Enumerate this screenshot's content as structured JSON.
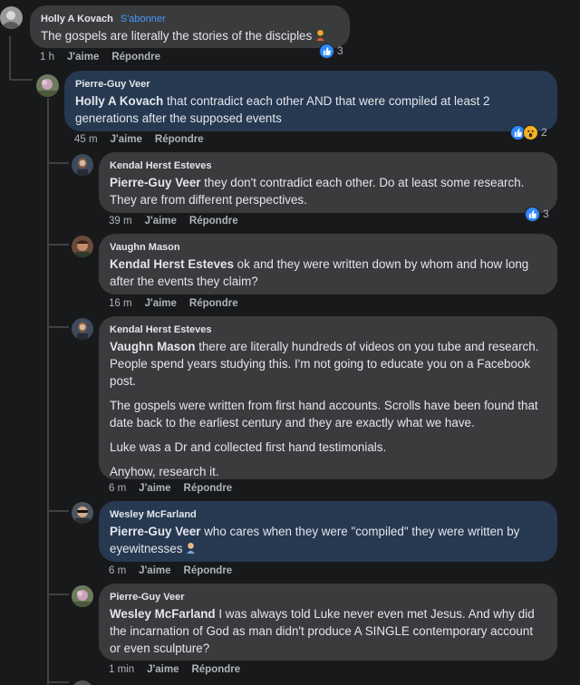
{
  "labels": {
    "like": "J'aime",
    "reply": "Répondre",
    "follow": "S'abonner"
  },
  "comments": [
    {
      "author": "Holly A Kovach",
      "mention": "",
      "text": "The gospels are literally the stories of the disciples",
      "time": "1 h",
      "reactions": "3"
    },
    {
      "author": "Pierre-Guy Veer",
      "mention": "Holly A Kovach",
      "text": " that contradict each other AND that were compiled at least 2 generations after the supposed events",
      "time": "45 m",
      "reactions": "2"
    },
    {
      "author": "Kendal Herst Esteves",
      "mention": "Pierre-Guy Veer",
      "text": " they don't contradict each other. Do at least some research. They are from different perspectives.",
      "time": "39 m",
      "reactions": "3"
    },
    {
      "author": "Vaughn Mason",
      "mention": "Kendal Herst Esteves",
      "text": " ok and they were written down by whom and how long after the events they claim?",
      "time": "16 m",
      "reactions": ""
    },
    {
      "author": "Kendal Herst Esteves",
      "mention": "Vaughn Mason",
      "text": " there are literally hundreds of videos on you tube and research. People spend years studying this. I'm not going to educate you on a Facebook post.",
      "paragraphs": [
        "The gospels were written from first hand accounts. Scrolls have been found that date back to the earliest century and they are exactly what we have.",
        "Luke was a Dr and collected first hand testimonials.",
        "Anyhow, research it."
      ],
      "time": "6 m",
      "reactions": ""
    },
    {
      "author": "Wesley McFarland",
      "mention": "Pierre-Guy Veer",
      "text": " who cares when they were \"compiled\" they were written by eyewitnesses",
      "time": "6 m",
      "reactions": ""
    },
    {
      "author": "Pierre-Guy Veer",
      "mention": "Wesley McFarland",
      "text": " I was always told Luke never even met Jesus. And why did the incarnation of God as man didn't produce A SINGLE contemporary account or even sculpture?",
      "time": "1 min",
      "reactions": ""
    }
  ],
  "icons": {
    "like": "thumbs-up-icon",
    "wow": "wow-face-icon",
    "person_emoji": "person-emoji-icon",
    "facepalm_emoji": "facepalm-emoji-icon"
  },
  "colors": {
    "bg": "#18191a",
    "bubble": "#3a3b3c",
    "bubble_highlight": "#263951",
    "link": "#4599ff",
    "like": "#2d88ff"
  }
}
